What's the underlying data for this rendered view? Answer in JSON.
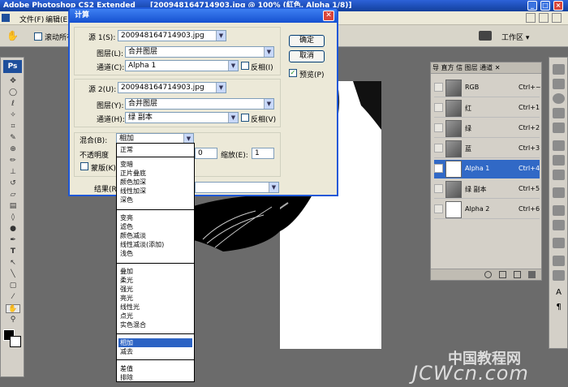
{
  "app_title": "Adobe Photoshop CS2 Extended",
  "doc_title": "[200948164714903.jpg @ 100% (紅色, Alpha 1/8)]",
  "menu": [
    "文件(F)",
    "编辑(E)"
  ],
  "options": {
    "scroll_all": "滚动所有",
    "workspace": "工作区 ▾"
  },
  "dialog": {
    "title": "计算",
    "source1": {
      "label": "源 1(S):",
      "file": "200948164714903.jpg",
      "layer_label": "图层(L):",
      "layer": "合并图层",
      "channel_label": "通道(C):",
      "channel": "Alpha 1",
      "invert": "反相(I)"
    },
    "source2": {
      "label": "源 2(U):",
      "file": "200948164714903.jpg",
      "layer_label": "图层(Y):",
      "layer": "合并图层",
      "channel_label": "通道(H):",
      "channel": "绿 副本",
      "invert": "反相(V)"
    },
    "blend": {
      "label": "混合(B):",
      "value": "相加",
      "opacity_label": "不透明度",
      "offset": "0",
      "scale_label": "缩放(E):",
      "scale": "1",
      "mask": "蒙版(K)"
    },
    "result_label": "结果(R):",
    "ok": "确定",
    "cancel": "取消",
    "preview": "预览(P)"
  },
  "blend_modes": {
    "group1": [
      "正常"
    ],
    "group2": [
      "变暗",
      "正片叠底",
      "颜色加深",
      "线性加深",
      "深色"
    ],
    "group3": [
      "变亮",
      "滤色",
      "颜色减淡",
      "线性减淡(添加)",
      "浅色"
    ],
    "group4": [
      "叠加",
      "柔光",
      "强光",
      "亮光",
      "线性光",
      "点光",
      "实色混合"
    ],
    "group5": [
      "相加",
      "减去"
    ],
    "group6": [
      "差值",
      "排除"
    ],
    "selected": "相加"
  },
  "channels_panel": {
    "tabs": "导 直方 信 图层 通道 ✕",
    "rows": [
      {
        "name": "RGB",
        "key": "Ctrl+~"
      },
      {
        "name": "红",
        "key": "Ctrl+1"
      },
      {
        "name": "绿",
        "key": "Ctrl+2"
      },
      {
        "name": "蓝",
        "key": "Ctrl+3"
      },
      {
        "name": "Alpha 1",
        "key": "Ctrl+4"
      },
      {
        "name": "绿 副本",
        "key": "Ctrl+5"
      },
      {
        "name": "Alpha 2",
        "key": "Ctrl+6"
      }
    ]
  },
  "watermark": {
    "line1": "中国教程网",
    "line2": "JCWcn.com"
  },
  "toolbox_logo": "Ps"
}
